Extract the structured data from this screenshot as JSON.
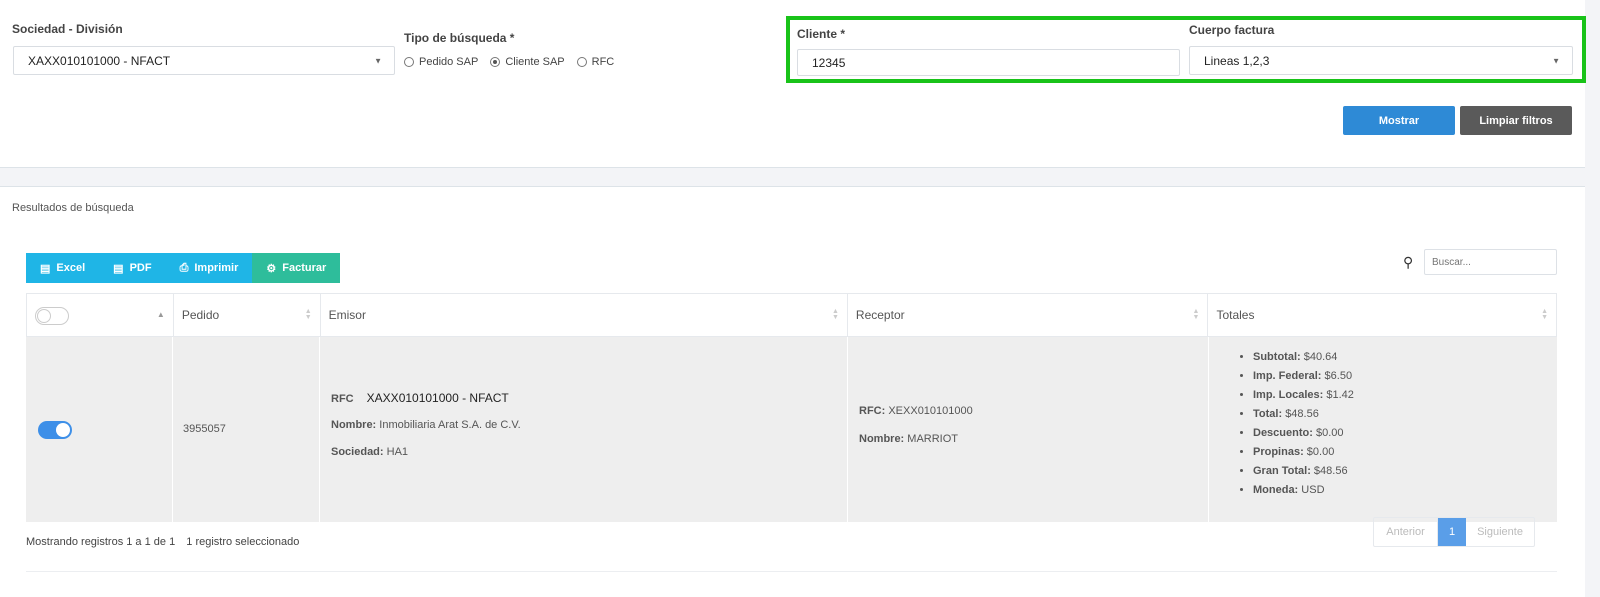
{
  "filters": {
    "sociedad_label": "Sociedad - División",
    "sociedad_value": "XAXX010101000 - NFACT",
    "tipo_label": "Tipo de búsqueda *",
    "tipo_options": [
      "Pedido SAP",
      "Cliente SAP",
      "RFC"
    ],
    "tipo_selected": "Cliente SAP",
    "cliente_label": "Cliente *",
    "cliente_value": "12345",
    "cuerpo_label": "Cuerpo factura",
    "cuerpo_value": "Lineas 1,2,3",
    "mostrar_label": "Mostrar",
    "limpiar_label": "Limpiar filtros"
  },
  "results": {
    "title": "Resultados de búsqueda",
    "toolbar": {
      "excel": "Excel",
      "pdf": "PDF",
      "imprimir": "Imprimir",
      "facturar": "Facturar"
    },
    "search_placeholder": "Buscar...",
    "columns": [
      "Pedido",
      "Emisor",
      "Receptor",
      "Totales"
    ],
    "row": {
      "selected": true,
      "pedido": "3955057",
      "emisor": {
        "rfc_label": "RFC",
        "rfc_value": "XAXX010101000 - NFACT",
        "nombre_label": "Nombre:",
        "nombre_value": "Inmobiliaria Arat S.A. de C.V.",
        "sociedad_label": "Sociedad:",
        "sociedad_value": "HA1"
      },
      "receptor": {
        "rfc_label": "RFC:",
        "rfc_value": "XEXX010101000",
        "nombre_label": "Nombre:",
        "nombre_value": "MARRIOT"
      },
      "totales": [
        {
          "label": "Subtotal:",
          "value": "$40.64"
        },
        {
          "label": "Imp. Federal:",
          "value": "$6.50"
        },
        {
          "label": "Imp. Locales:",
          "value": "$1.42"
        },
        {
          "label": "Total:",
          "value": "$48.56"
        },
        {
          "label": "Descuento:",
          "value": "$0.00"
        },
        {
          "label": "Propinas:",
          "value": "$0.00"
        },
        {
          "label": "Gran Total:",
          "value": "$48.56"
        },
        {
          "label": "Moneda:",
          "value": "USD"
        }
      ]
    },
    "footer_info": "Mostrando registros 1 a 1 de 1",
    "footer_selected": "1 registro seleccionado",
    "pager": {
      "prev": "Anterior",
      "page": "1",
      "next": "Siguiente"
    }
  },
  "colors": {
    "primary": "#2e8ad6",
    "secondary": "#5a5a5a",
    "toolbar": "#1fb5e6",
    "facturar": "#2ebd9b",
    "highlight": "#19c319",
    "toggle_on": "#3d8fe8",
    "page_active": "#5a9ee8"
  }
}
